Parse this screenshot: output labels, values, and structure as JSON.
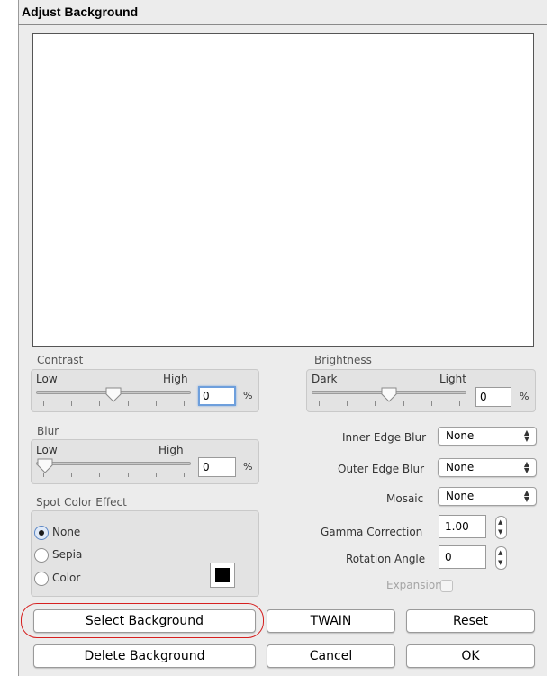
{
  "dialog": {
    "title": "Adjust Background"
  },
  "contrast": {
    "label": "Contrast",
    "low_label": "Low",
    "high_label": "High",
    "value": "0",
    "unit": "%",
    "level": 0.5
  },
  "brightness": {
    "label": "Brightness",
    "low_label": "Dark",
    "high_label": "Light",
    "value": "0",
    "unit": "%",
    "level": 0.5
  },
  "blur": {
    "label": "Blur",
    "low_label": "Low",
    "high_label": "High",
    "value": "0",
    "unit": "%",
    "level": 0.0
  },
  "spot_color_effect": {
    "label": "Spot Color Effect",
    "options": [
      {
        "label": "None",
        "selected": true
      },
      {
        "label": "Sepia",
        "selected": false
      },
      {
        "label": "Color",
        "selected": false
      }
    ],
    "swatch_color": "#000000"
  },
  "inner_edge_blur": {
    "label": "Inner Edge Blur",
    "value": "None"
  },
  "outer_edge_blur": {
    "label": "Outer Edge Blur",
    "value": "None"
  },
  "mosaic": {
    "label": "Mosaic",
    "value": "None"
  },
  "gamma_correction": {
    "label": "Gamma Correction",
    "value": "1.00"
  },
  "rotation_angle": {
    "label": "Rotation Angle",
    "value": "0"
  },
  "expansion": {
    "label": "Expansion",
    "checked": false
  },
  "buttons": {
    "select_background": "Select Background",
    "twain": "TWAIN",
    "reset": "Reset",
    "delete_background": "Delete Background",
    "cancel": "Cancel",
    "ok": "OK"
  },
  "colors": {
    "highlight": "#d62020",
    "focus": "#6e9fdc"
  }
}
